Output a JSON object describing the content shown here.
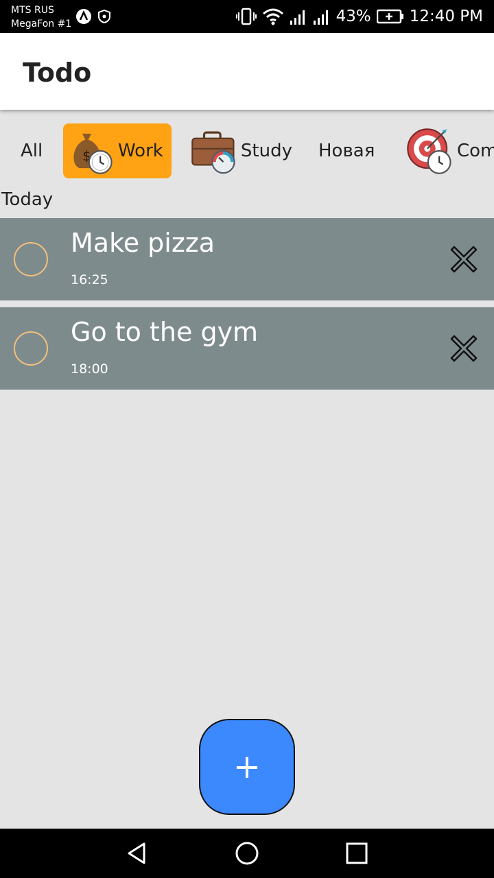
{
  "status_bar": {
    "carrier_line1": "MTS RUS",
    "carrier_line2": "MegaFon #1",
    "battery": "43%",
    "time": "12:40 PM"
  },
  "app_bar": {
    "title": "Todo"
  },
  "tabs": [
    {
      "label": "All",
      "icon": "none",
      "active": false
    },
    {
      "label": "Work",
      "icon": "money-bag-clock-icon",
      "active": true
    },
    {
      "label": "Study",
      "icon": "briefcase-gauge-icon",
      "active": false
    },
    {
      "label": "Новая",
      "icon": "none",
      "active": false
    },
    {
      "label": "Com",
      "icon": "target-clock-icon",
      "active": false
    }
  ],
  "section_label": "Today",
  "tasks": [
    {
      "title": "Make pizza",
      "time": "16:25"
    },
    {
      "title": "Go to the gym",
      "time": "18:00"
    }
  ],
  "fab": {
    "label": "+"
  },
  "colors": {
    "accent": "#ffa214",
    "task_bg": "#7e8b8c",
    "fab": "#3c88fd",
    "checkbox_border": "#f4c07d",
    "background": "#e4e4e4"
  }
}
